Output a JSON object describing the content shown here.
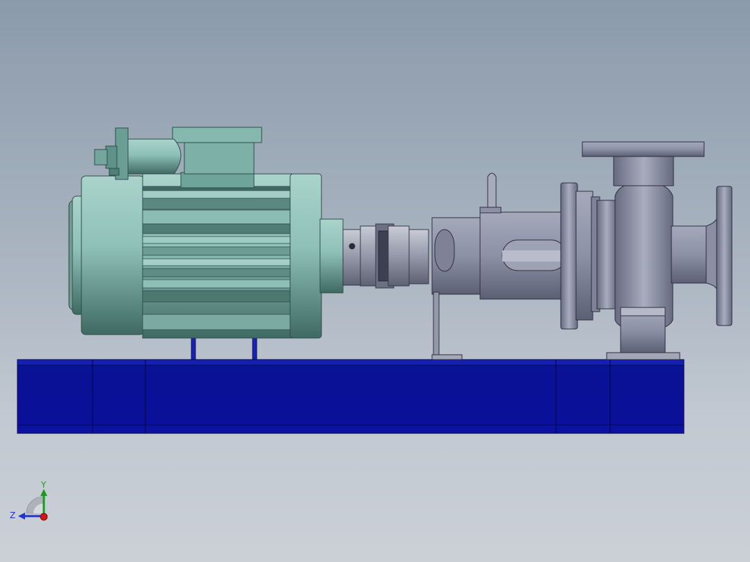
{
  "viewport": {
    "background_top": "#8b9aab",
    "background_bottom": "#cbd0d7"
  },
  "model": {
    "baseplate_color": "#0a0f9a",
    "motor_color": "#7fb3a9",
    "pump_color": "#8c91a6",
    "coupling_color": "#9aa0b0"
  },
  "triad": {
    "y_label": "Y",
    "z_label": "Z",
    "y_color": "#1a9a1a",
    "z_color": "#2233cc",
    "x_color": "#cc1a1a"
  }
}
